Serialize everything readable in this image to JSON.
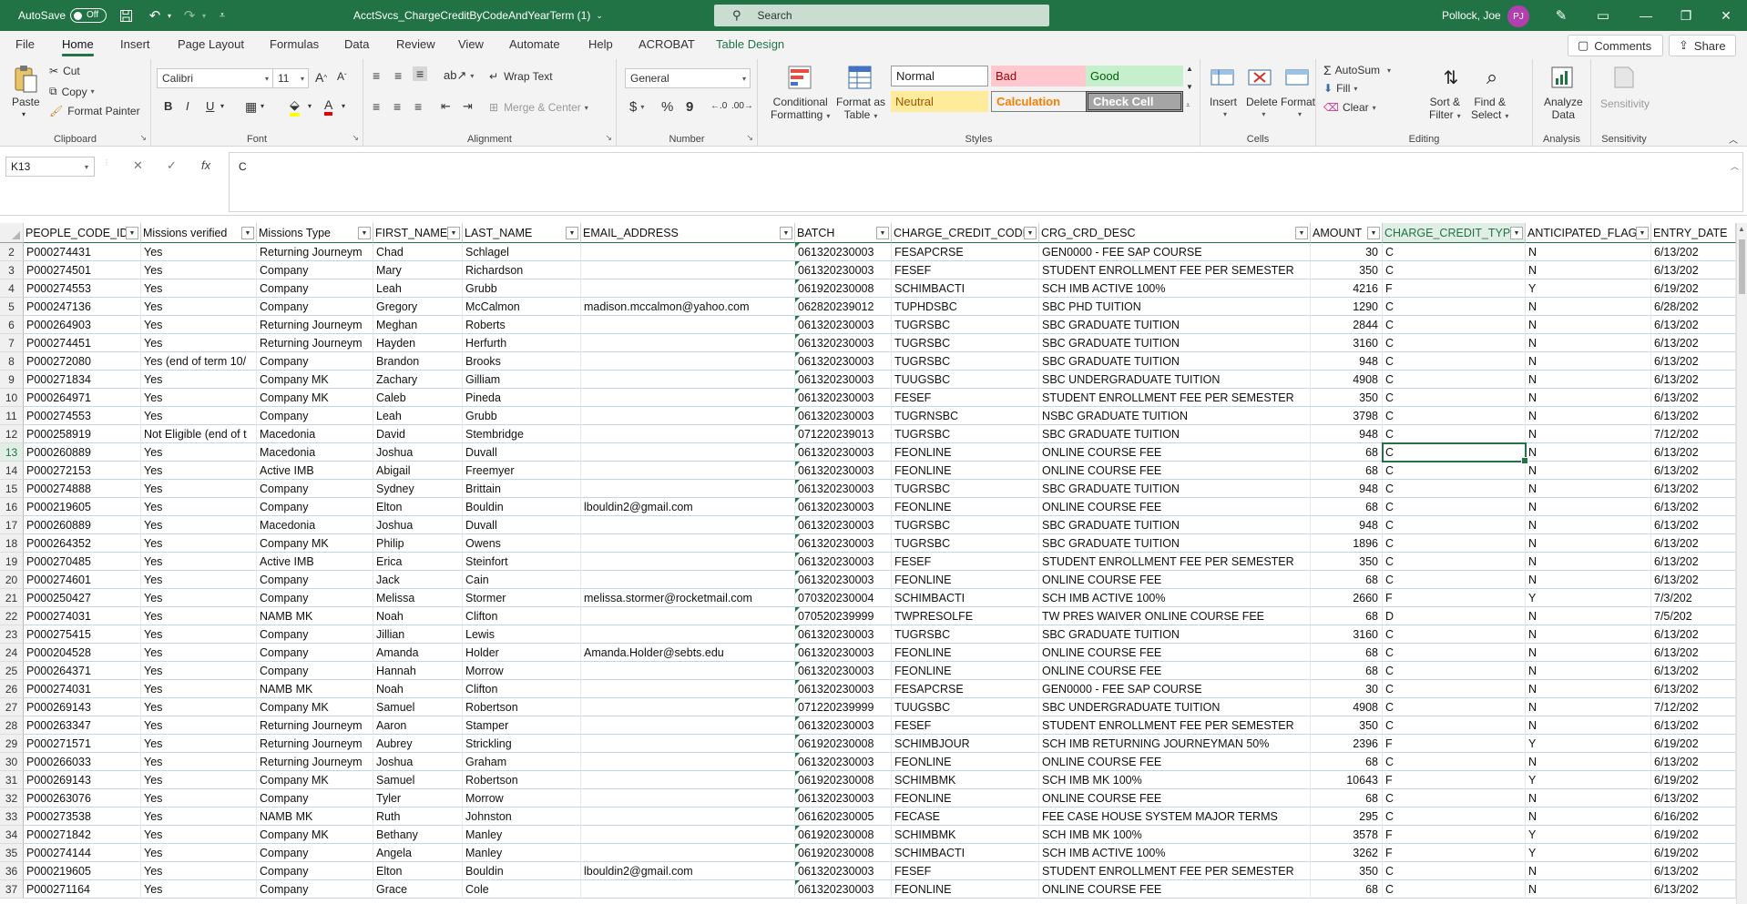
{
  "titlebar": {
    "autosave_label": "AutoSave",
    "autosave_state": "Off",
    "document_title": "AcctSvcs_ChargeCreditByCodeAndYearTerm (1)",
    "search_placeholder": "Search",
    "user_name": "Pollock, Joe",
    "user_initials": "PJ"
  },
  "tabs": [
    "File",
    "Home",
    "Insert",
    "Page Layout",
    "Formulas",
    "Data",
    "Review",
    "View",
    "Automate",
    "Help",
    "ACROBAT",
    "Table Design"
  ],
  "active_tab": "Home",
  "comments_label": "Comments",
  "share_label": "Share",
  "ribbon": {
    "clipboard": {
      "paste": "Paste",
      "cut": "Cut",
      "copy": "Copy",
      "format_painter": "Format Painter",
      "label": "Clipboard"
    },
    "font": {
      "name": "Calibri",
      "size": "11",
      "bold": "B",
      "italic": "I",
      "underline": "U",
      "label": "Font"
    },
    "alignment": {
      "wrap_text": "Wrap Text",
      "merge_center": "Merge & Center",
      "label": "Alignment"
    },
    "number": {
      "format": "General",
      "currency": "$",
      "percent": "%",
      "comma": "9",
      "label": "Number"
    },
    "styles": {
      "conditional_formatting": [
        "Conditional",
        "Formatting"
      ],
      "format_as_table": [
        "Format as",
        "Table"
      ],
      "normal": "Normal",
      "bad": "Bad",
      "good": "Good",
      "neutral": "Neutral",
      "calculation": "Calculation",
      "check_cell": "Check Cell",
      "label": "Styles"
    },
    "cells": {
      "insert": "Insert",
      "delete": "Delete",
      "format": "Format",
      "label": "Cells"
    },
    "editing": {
      "autosum": "AutoSum",
      "fill": "Fill",
      "clear": "Clear",
      "sort_filter": [
        "Sort &",
        "Filter"
      ],
      "find_select": [
        "Find &",
        "Select"
      ],
      "label": "Editing"
    },
    "analysis": {
      "analyze_data": [
        "Analyze",
        "Data"
      ],
      "label": "Analysis"
    },
    "sensitivity": {
      "button": "Sensitivity",
      "label": "Sensitivity"
    }
  },
  "formula_bar": {
    "name_box": "K13",
    "formula": "C"
  },
  "colors": {
    "accent": "#217346",
    "bad_bg": "#ffc7ce",
    "bad_fg": "#9c0006",
    "good_bg": "#c6efce",
    "good_fg": "#006100",
    "neutral_bg": "#ffeb9c",
    "neutral_fg": "#9c5700",
    "calc_bg": "#f2f2f2",
    "calc_fg": "#fa7d00",
    "check_bg": "#a5a5a5"
  },
  "grid": {
    "headers": [
      "PEOPLE_CODE_ID",
      "Missions verified",
      "Missions Type",
      "FIRST_NAME",
      "LAST_NAME",
      "EMAIL_ADDRESS",
      "BATCH",
      "CHARGE_CREDIT_CODE",
      "CRG_CRD_DESC",
      "AMOUNT",
      "CHARGE_CREDIT_TYPE",
      "ANTICIPATED_FLAG",
      "ENTRY_DATE"
    ],
    "selected_column": 10,
    "active_row": 13,
    "rows": [
      {
        "n": "2",
        "c": [
          "P000274431",
          "Yes",
          "Returning Journeym",
          "Chad",
          "Schlagel",
          "",
          "061320230003",
          "FESAPCRSE",
          "GEN0000 - FEE SAP COURSE",
          "30",
          "C",
          "N",
          "6/13/202"
        ]
      },
      {
        "n": "3",
        "c": [
          "P000274501",
          "Yes",
          "Company",
          "Mary",
          "Richardson",
          "",
          "061320230003",
          "FESEF",
          "STUDENT ENROLLMENT FEE PER SEMESTER",
          "350",
          "C",
          "N",
          "6/13/202"
        ]
      },
      {
        "n": "4",
        "c": [
          "P000274553",
          "Yes",
          "Company",
          "Leah",
          "Grubb",
          "",
          "061920230008",
          "SCHIMBACTI",
          "SCH IMB ACTIVE 100%",
          "4216",
          "F",
          "Y",
          "6/19/202"
        ]
      },
      {
        "n": "5",
        "c": [
          "P000247136",
          "Yes",
          "Company",
          "Gregory",
          "McCalmon",
          "madison.mccalmon@yahoo.com",
          "062820239012",
          "TUPHDSBC",
          "SBC PHD TUITION",
          "1290",
          "C",
          "N",
          "6/28/202"
        ]
      },
      {
        "n": "6",
        "c": [
          "P000264903",
          "Yes",
          "Returning Journeym",
          "Meghan",
          "Roberts",
          "",
          "061320230003",
          "TUGRSBC",
          "SBC GRADUATE TUITION",
          "2844",
          "C",
          "N",
          "6/13/202"
        ]
      },
      {
        "n": "7",
        "c": [
          "P000274451",
          "Yes",
          "Returning Journeym",
          "Hayden",
          "Herfurth",
          "",
          "061320230003",
          "TUGRSBC",
          "SBC GRADUATE TUITION",
          "3160",
          "C",
          "N",
          "6/13/202"
        ]
      },
      {
        "n": "8",
        "c": [
          "P000272080",
          "Yes (end of term 10/",
          "Company",
          "Brandon",
          "Brooks",
          "",
          "061320230003",
          "TUGRSBC",
          "SBC GRADUATE TUITION",
          "948",
          "C",
          "N",
          "6/13/202"
        ]
      },
      {
        "n": "9",
        "c": [
          "P000271834",
          "Yes",
          "Company MK",
          "Zachary",
          "Gilliam",
          "",
          "061320230003",
          "TUUGSBC",
          "SBC UNDERGRADUATE TUITION",
          "4908",
          "C",
          "N",
          "6/13/202"
        ]
      },
      {
        "n": "10",
        "c": [
          "P000264971",
          "Yes",
          "Company MK",
          "Caleb",
          "Pineda",
          "",
          "061320230003",
          "FESEF",
          "STUDENT ENROLLMENT FEE PER SEMESTER",
          "350",
          "C",
          "N",
          "6/13/202"
        ]
      },
      {
        "n": "11",
        "c": [
          "P000274553",
          "Yes",
          "Company",
          "Leah",
          "Grubb",
          "",
          "061320230003",
          "TUGRNSBC",
          "NSBC GRADUATE TUITION",
          "3798",
          "C",
          "N",
          "6/13/202"
        ]
      },
      {
        "n": "12",
        "c": [
          "P000258919",
          "Not Eligible (end of t",
          "Macedonia",
          "David",
          "Stembridge",
          "",
          "071220239013",
          "TUGRSBC",
          "SBC GRADUATE TUITION",
          "948",
          "C",
          "N",
          "7/12/202"
        ]
      },
      {
        "n": "13",
        "c": [
          "P000260889",
          "Yes",
          "Macedonia",
          "Joshua",
          "Duvall",
          "",
          "061320230003",
          "FEONLINE",
          "ONLINE COURSE FEE",
          "68",
          "C",
          "N",
          "6/13/202"
        ]
      },
      {
        "n": "14",
        "c": [
          "P000272153",
          "Yes",
          "Active IMB",
          "Abigail",
          "Freemyer",
          "",
          "061320230003",
          "FEONLINE",
          "ONLINE COURSE FEE",
          "68",
          "C",
          "N",
          "6/13/202"
        ]
      },
      {
        "n": "15",
        "c": [
          "P000274888",
          "Yes",
          "Company",
          "Sydney",
          "Brittain",
          "",
          "061320230003",
          "TUGRSBC",
          "SBC GRADUATE TUITION",
          "948",
          "C",
          "N",
          "6/13/202"
        ]
      },
      {
        "n": "16",
        "c": [
          "P000219605",
          "Yes",
          "Company",
          "Elton",
          "Bouldin",
          "lbouldin2@gmail.com",
          "061320230003",
          "FEONLINE",
          "ONLINE COURSE FEE",
          "68",
          "C",
          "N",
          "6/13/202"
        ]
      },
      {
        "n": "17",
        "c": [
          "P000260889",
          "Yes",
          "Macedonia",
          "Joshua",
          "Duvall",
          "",
          "061320230003",
          "TUGRSBC",
          "SBC GRADUATE TUITION",
          "948",
          "C",
          "N",
          "6/13/202"
        ]
      },
      {
        "n": "18",
        "c": [
          "P000264352",
          "Yes",
          "Company MK",
          "Philip",
          "Owens",
          "",
          "061320230003",
          "TUGRSBC",
          "SBC GRADUATE TUITION",
          "1896",
          "C",
          "N",
          "6/13/202"
        ]
      },
      {
        "n": "19",
        "c": [
          "P000270485",
          "Yes",
          "Active IMB",
          "Erica",
          "Steinfort",
          "",
          "061320230003",
          "FESEF",
          "STUDENT ENROLLMENT FEE PER SEMESTER",
          "350",
          "C",
          "N",
          "6/13/202"
        ]
      },
      {
        "n": "20",
        "c": [
          "P000274601",
          "Yes",
          "Company",
          "Jack",
          "Cain",
          "",
          "061320230003",
          "FEONLINE",
          "ONLINE COURSE FEE",
          "68",
          "C",
          "N",
          "6/13/202"
        ]
      },
      {
        "n": "21",
        "c": [
          "P000250427",
          "Yes",
          "Company",
          "Melissa",
          "Stormer",
          "melissa.stormer@rocketmail.com",
          "070320230004",
          "SCHIMBACTI",
          "SCH IMB ACTIVE 100%",
          "2660",
          "F",
          "Y",
          "7/3/202"
        ]
      },
      {
        "n": "22",
        "c": [
          "P000274031",
          "Yes",
          "NAMB MK",
          "Noah",
          "Clifton",
          "",
          "070520239999",
          "TWPRESOLFE",
          "TW PRES WAIVER ONLINE COURSE FEE",
          "68",
          "D",
          "N",
          "7/5/202"
        ]
      },
      {
        "n": "23",
        "c": [
          "P000275415",
          "Yes",
          "Company",
          "Jillian",
          "Lewis",
          "",
          "061320230003",
          "TUGRSBC",
          "SBC GRADUATE TUITION",
          "3160",
          "C",
          "N",
          "6/13/202"
        ]
      },
      {
        "n": "24",
        "c": [
          "P000204528",
          "Yes",
          "Company",
          "Amanda",
          "Holder",
          "Amanda.Holder@sebts.edu",
          "061320230003",
          "FEONLINE",
          "ONLINE COURSE FEE",
          "68",
          "C",
          "N",
          "6/13/202"
        ]
      },
      {
        "n": "25",
        "c": [
          "P000264371",
          "Yes",
          "Company",
          "Hannah",
          "Morrow",
          "",
          "061320230003",
          "FEONLINE",
          "ONLINE COURSE FEE",
          "68",
          "C",
          "N",
          "6/13/202"
        ]
      },
      {
        "n": "26",
        "c": [
          "P000274031",
          "Yes",
          "NAMB MK",
          "Noah",
          "Clifton",
          "",
          "061320230003",
          "FESAPCRSE",
          "GEN0000 - FEE SAP COURSE",
          "30",
          "C",
          "N",
          "6/13/202"
        ]
      },
      {
        "n": "27",
        "c": [
          "P000269143",
          "Yes",
          "Company MK",
          "Samuel",
          "Robertson",
          "",
          "071220239999",
          "TUUGSBC",
          "SBC UNDERGRADUATE TUITION",
          "4908",
          "C",
          "N",
          "7/12/202"
        ]
      },
      {
        "n": "28",
        "c": [
          "P000263347",
          "Yes",
          "Returning Journeym",
          "Aaron",
          "Stamper",
          "",
          "061320230003",
          "FESEF",
          "STUDENT ENROLLMENT FEE PER SEMESTER",
          "350",
          "C",
          "N",
          "6/13/202"
        ]
      },
      {
        "n": "29",
        "c": [
          "P000271571",
          "Yes",
          "Returning Journeym",
          "Aubrey",
          "Strickling",
          "",
          "061920230008",
          "SCHIMBJOUR",
          "SCH IMB RETURNING JOURNEYMAN 50%",
          "2396",
          "F",
          "Y",
          "6/19/202"
        ]
      },
      {
        "n": "30",
        "c": [
          "P000266033",
          "Yes",
          "Returning Journeym",
          "Joshua",
          "Graham",
          "",
          "061320230003",
          "FEONLINE",
          "ONLINE COURSE FEE",
          "68",
          "C",
          "N",
          "6/13/202"
        ]
      },
      {
        "n": "31",
        "c": [
          "P000269143",
          "Yes",
          "Company MK",
          "Samuel",
          "Robertson",
          "",
          "061920230008",
          "SCHIMBMK",
          "SCH IMB MK 100%",
          "10643",
          "F",
          "Y",
          "6/19/202"
        ]
      },
      {
        "n": "32",
        "c": [
          "P000263076",
          "Yes",
          "Company",
          "Tyler",
          "Morrow",
          "",
          "061320230003",
          "FEONLINE",
          "ONLINE COURSE FEE",
          "68",
          "C",
          "N",
          "6/13/202"
        ]
      },
      {
        "n": "33",
        "c": [
          "P000273538",
          "Yes",
          "NAMB MK",
          "Ruth",
          "Johnston",
          "",
          "061620230005",
          "FECASE",
          "FEE CASE HOUSE SYSTEM MAJOR TERMS",
          "295",
          "C",
          "N",
          "6/16/202"
        ]
      },
      {
        "n": "34",
        "c": [
          "P000271842",
          "Yes",
          "Company MK",
          "Bethany",
          "Manley",
          "",
          "061920230008",
          "SCHIMBMK",
          "SCH IMB MK 100%",
          "3578",
          "F",
          "Y",
          "6/19/202"
        ]
      },
      {
        "n": "35",
        "c": [
          "P000274144",
          "Yes",
          "Company",
          "Angela",
          "Manley",
          "",
          "061920230008",
          "SCHIMBACTI",
          "SCH IMB ACTIVE 100%",
          "3262",
          "F",
          "Y",
          "6/19/202"
        ]
      },
      {
        "n": "36",
        "c": [
          "P000219605",
          "Yes",
          "Company",
          "Elton",
          "Bouldin",
          "lbouldin2@gmail.com",
          "061320230003",
          "FESEF",
          "STUDENT ENROLLMENT FEE PER SEMESTER",
          "350",
          "C",
          "N",
          "6/13/202"
        ]
      },
      {
        "n": "37",
        "c": [
          "P000271164",
          "Yes",
          "Company",
          "Grace",
          "Cole",
          "",
          "061320230003",
          "FEONLINE",
          "ONLINE COURSE FEE",
          "68",
          "C",
          "N",
          "6/13/202"
        ]
      }
    ]
  }
}
